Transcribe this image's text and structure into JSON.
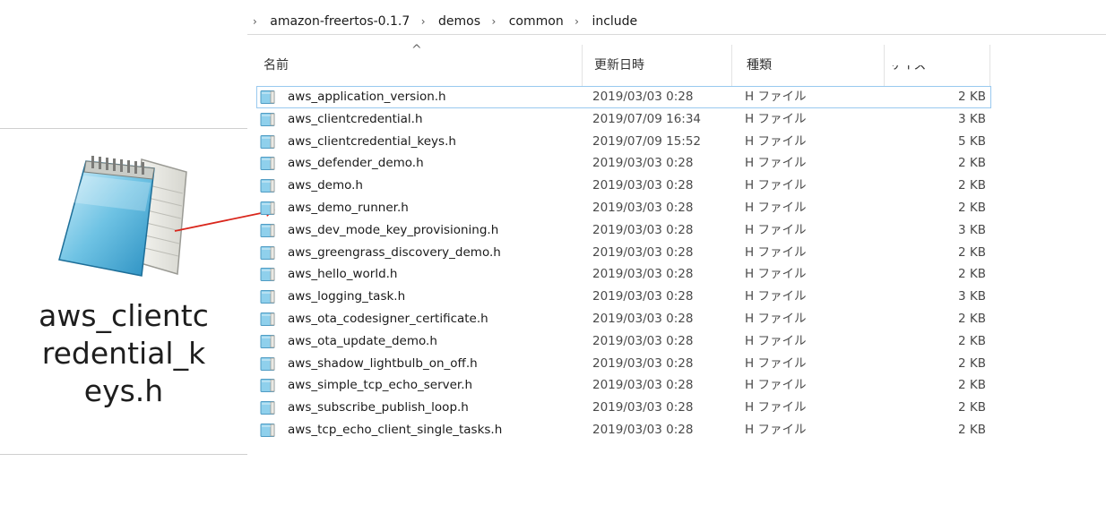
{
  "zoom": {
    "label_lines": [
      "aws_clientc",
      "redential_k",
      "eys.h"
    ],
    "icon": "notepad-file-icon",
    "arrow_color": "#d9261c"
  },
  "address": {
    "crumbs": [
      "amazon-freertos-0.1.7",
      "demos",
      "common",
      "include"
    ],
    "separator": "›"
  },
  "columns": {
    "name": "名前",
    "date": "更新日時",
    "type": "種類",
    "size": "サイズ",
    "sort_indicator": "^"
  },
  "files": [
    {
      "name": "aws_application_version.h",
      "date": "2019/03/03 0:28",
      "type": "H ファイル",
      "size": "2 KB"
    },
    {
      "name": "aws_clientcredential.h",
      "date": "2019/07/09 16:34",
      "type": "H ファイル",
      "size": "3 KB"
    },
    {
      "name": "aws_clientcredential_keys.h",
      "date": "2019/07/09 15:52",
      "type": "H ファイル",
      "size": "5 KB"
    },
    {
      "name": "aws_defender_demo.h",
      "date": "2019/03/03 0:28",
      "type": "H ファイル",
      "size": "2 KB"
    },
    {
      "name": "aws_demo.h",
      "date": "2019/03/03 0:28",
      "type": "H ファイル",
      "size": "2 KB"
    },
    {
      "name": "aws_demo_runner.h",
      "date": "2019/03/03 0:28",
      "type": "H ファイル",
      "size": "2 KB"
    },
    {
      "name": "aws_dev_mode_key_provisioning.h",
      "date": "2019/03/03 0:28",
      "type": "H ファイル",
      "size": "3 KB"
    },
    {
      "name": "aws_greengrass_discovery_demo.h",
      "date": "2019/03/03 0:28",
      "type": "H ファイル",
      "size": "2 KB"
    },
    {
      "name": "aws_hello_world.h",
      "date": "2019/03/03 0:28",
      "type": "H ファイル",
      "size": "2 KB"
    },
    {
      "name": "aws_logging_task.h",
      "date": "2019/03/03 0:28",
      "type": "H ファイル",
      "size": "3 KB"
    },
    {
      "name": "aws_ota_codesigner_certificate.h",
      "date": "2019/03/03 0:28",
      "type": "H ファイル",
      "size": "2 KB"
    },
    {
      "name": "aws_ota_update_demo.h",
      "date": "2019/03/03 0:28",
      "type": "H ファイル",
      "size": "2 KB"
    },
    {
      "name": "aws_shadow_lightbulb_on_off.h",
      "date": "2019/03/03 0:28",
      "type": "H ファイル",
      "size": "2 KB"
    },
    {
      "name": "aws_simple_tcp_echo_server.h",
      "date": "2019/03/03 0:28",
      "type": "H ファイル",
      "size": "2 KB"
    },
    {
      "name": "aws_subscribe_publish_loop.h",
      "date": "2019/03/03 0:28",
      "type": "H ファイル",
      "size": "2 KB"
    },
    {
      "name": "aws_tcp_echo_client_single_tasks.h",
      "date": "2019/03/03 0:28",
      "type": "H ファイル",
      "size": "2 KB"
    }
  ],
  "selected_index": 0,
  "file_icon": "text-file-icon"
}
